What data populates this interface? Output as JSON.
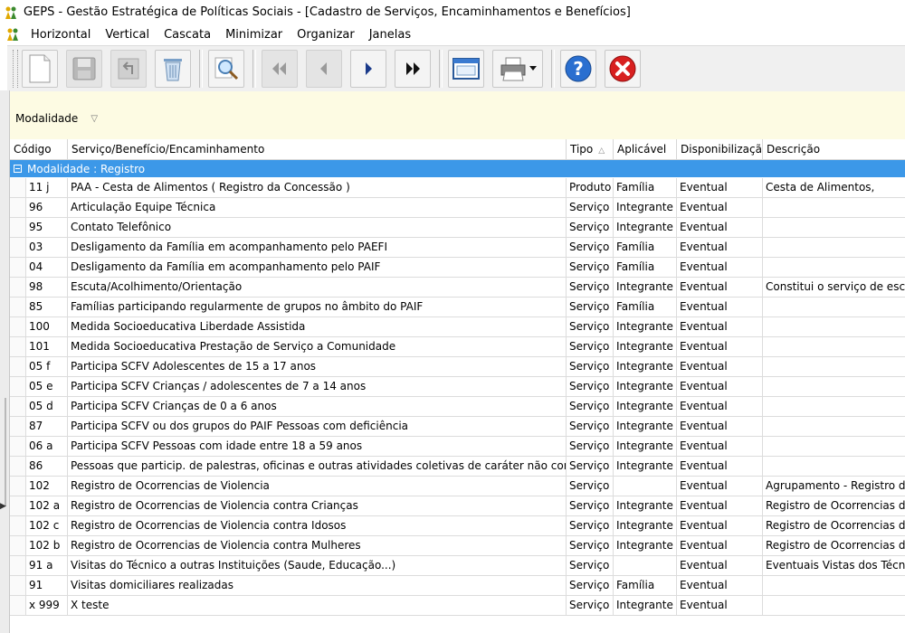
{
  "window": {
    "title": "GEPS - Gestão Estratégica de Políticas Sociais - [Cadastro de Serviços, Encaminhamentos e Benefícios]"
  },
  "menu": [
    "Horizontal",
    "Vertical",
    "Cascata",
    "Minimizar",
    "Organizar",
    "Janelas"
  ],
  "group_panel": {
    "label": "Modalidade"
  },
  "columns": {
    "codigo": "Código",
    "servico": "Serviço/Benefício/Encaminhamento",
    "tipo": "Tipo",
    "aplicavel": "Aplicável",
    "disponibilizacao": "Disponibilização",
    "descricao": "Descrição"
  },
  "group_row": {
    "label": "Modalidade : Registro"
  },
  "rows": [
    {
      "codigo": "11 j",
      "servico": "PAA - Cesta de Alimentos ( Registro da Concessão )",
      "tipo": "Produto",
      "aplicavel": "Família",
      "disp": "Eventual",
      "desc": "Cesta de Alimentos,"
    },
    {
      "codigo": "96",
      "servico": "Articulação Equipe Técnica",
      "tipo": "Serviço",
      "aplicavel": "Integrante",
      "disp": "Eventual",
      "desc": ""
    },
    {
      "codigo": "95",
      "servico": "Contato Telefônico",
      "tipo": "Serviço",
      "aplicavel": "Integrante",
      "disp": "Eventual",
      "desc": ""
    },
    {
      "codigo": "03",
      "servico": "Desligamento da Família em acompanhamento pelo PAEFI",
      "tipo": "Serviço",
      "aplicavel": "Família",
      "disp": "Eventual",
      "desc": ""
    },
    {
      "codigo": "04",
      "servico": "Desligamento da Família em acompanhamento pelo PAIF",
      "tipo": "Serviço",
      "aplicavel": "Família",
      "disp": "Eventual",
      "desc": ""
    },
    {
      "codigo": "98",
      "servico": "Escuta/Acolhimento/Orientação",
      "tipo": "Serviço",
      "aplicavel": "Integrante",
      "disp": "Eventual",
      "desc": "Constitui o serviço de escut"
    },
    {
      "codigo": "85",
      "servico": "Famílias participando regularmente de grupos no âmbito do PAIF",
      "tipo": "Serviço",
      "aplicavel": "Família",
      "disp": "Eventual",
      "desc": ""
    },
    {
      "codigo": "100",
      "servico": "Medida Socioeducativa Liberdade Assistida",
      "tipo": "Serviço",
      "aplicavel": "Integrante",
      "disp": "Eventual",
      "desc": ""
    },
    {
      "codigo": "101",
      "servico": "Medida Socioeducativa Prestação de Serviço a Comunidade",
      "tipo": "Serviço",
      "aplicavel": "Integrante",
      "disp": "Eventual",
      "desc": ""
    },
    {
      "codigo": "05 f",
      "servico": "Participa SCFV Adolescentes de 15 a 17 anos",
      "tipo": "Serviço",
      "aplicavel": "Integrante",
      "disp": "Eventual",
      "desc": ""
    },
    {
      "codigo": "05 e",
      "servico": "Participa SCFV Crianças / adolescentes de 7 a 14 anos",
      "tipo": "Serviço",
      "aplicavel": "Integrante",
      "disp": "Eventual",
      "desc": ""
    },
    {
      "codigo": "05 d",
      "servico": "Participa SCFV Crianças de 0 a 6 anos",
      "tipo": "Serviço",
      "aplicavel": "Integrante",
      "disp": "Eventual",
      "desc": ""
    },
    {
      "codigo": "87",
      "servico": "Participa SCFV ou dos grupos do PAIF Pessoas com deficiência",
      "tipo": "Serviço",
      "aplicavel": "Integrante",
      "disp": "Eventual",
      "desc": ""
    },
    {
      "codigo": "06 a",
      "servico": "Participa SCFV Pessoas com idade entre 18 a 59 anos",
      "tipo": "Serviço",
      "aplicavel": "Integrante",
      "disp": "Eventual",
      "desc": ""
    },
    {
      "codigo": "86",
      "servico": "Pessoas que particip. de palestras, oficinas e outras atividades coletivas de caráter não continua",
      "tipo": "Serviço",
      "aplicavel": "Integrante",
      "disp": "Eventual",
      "desc": ""
    },
    {
      "codigo": "102",
      "servico": "Registro de Ocorrencias de Violencia",
      "tipo": "Serviço",
      "aplicavel": "",
      "disp": "Eventual",
      "desc": "Agrupamento - Registro de"
    },
    {
      "codigo": "102 a",
      "servico": "Registro de Ocorrencias de Violencia contra Crianças",
      "tipo": "Serviço",
      "aplicavel": "Integrante",
      "disp": "Eventual",
      "desc": "Registro de Ocorrencias de"
    },
    {
      "codigo": "102 c",
      "servico": "Registro de Ocorrencias de Violencia contra Idosos",
      "tipo": "Serviço",
      "aplicavel": "Integrante",
      "disp": "Eventual",
      "desc": "Registro de Ocorrencias de"
    },
    {
      "codigo": "102 b",
      "servico": "Registro de Ocorrencias de Violencia contra Mulheres",
      "tipo": "Serviço",
      "aplicavel": "Integrante",
      "disp": "Eventual",
      "desc": "Registro de Ocorrencias de"
    },
    {
      "codigo": "91 a",
      "servico": "Visitas do Técnico a outras Instituições (Saude, Educação...)",
      "tipo": "Serviço",
      "aplicavel": "",
      "disp": "Eventual",
      "desc": "Eventuais Vistas dos Técnic"
    },
    {
      "codigo": "91",
      "servico": "Visitas domiciliares realizadas",
      "tipo": "Serviço",
      "aplicavel": "Família",
      "disp": "Eventual",
      "desc": ""
    },
    {
      "codigo": "x 999",
      "servico": "X teste",
      "tipo": "Serviço",
      "aplicavel": "Integrante",
      "disp": "Eventual",
      "desc": ""
    }
  ]
}
